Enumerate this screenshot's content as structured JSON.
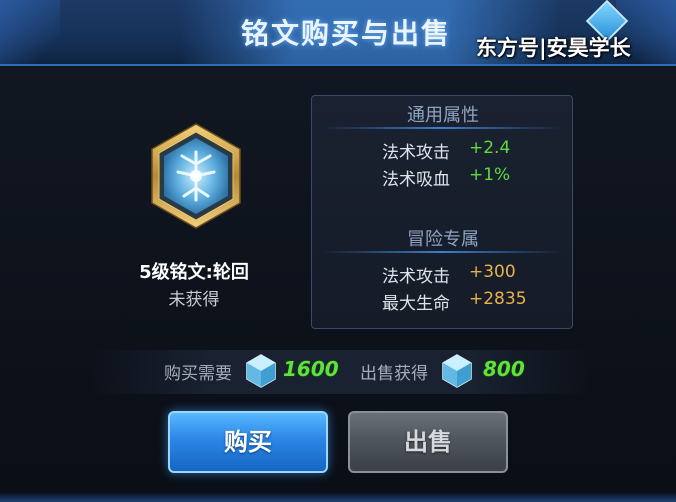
{
  "header": {
    "title": "铭文购买与出售",
    "watermark": "东方号|安昊学长"
  },
  "rune": {
    "name": "5级铭文:轮回",
    "status": "未获得"
  },
  "stats": {
    "general": {
      "title": "通用属性",
      "items": [
        {
          "label": "法术攻击",
          "value": "+2.4"
        },
        {
          "label": "法术吸血",
          "value": "+1%"
        }
      ]
    },
    "adventure": {
      "title": "冒险专属",
      "items": [
        {
          "label": "法术攻击",
          "value": "+300"
        },
        {
          "label": "最大生命",
          "value": "+2835"
        }
      ]
    }
  },
  "price": {
    "buy_label": "购买需要",
    "buy_value": "1600",
    "sell_label": "出售获得",
    "sell_value": "800",
    "currency_icon": "crystal-gem-icon"
  },
  "buttons": {
    "buy": "购买",
    "sell": "出售"
  },
  "colors": {
    "stat_general": "#5fdc3a",
    "stat_adventure": "#e8b24a",
    "price_value": "#5fe23a",
    "buy_button": "#2b86e6",
    "sell_button": "#4e545c"
  }
}
